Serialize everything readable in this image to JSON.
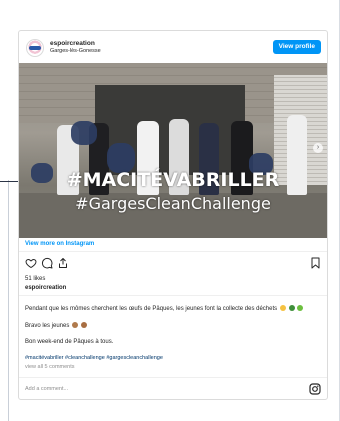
{
  "header": {
    "username": "espoircreation",
    "location": "Garges-lès-Gonesse",
    "view_profile": "View profile"
  },
  "photo": {
    "overlay_title": "#MACITÉVABRILLER",
    "overlay_subtitle": "#GargesCleanChallenge"
  },
  "view_more": "View more on Instagram",
  "icons": [
    "heart-icon",
    "comment-icon",
    "share-icon",
    "bookmark-icon",
    "instagram-icon"
  ],
  "post": {
    "likes": "51 likes",
    "owner": "espoircreation",
    "caption_line1": "Pendant que les mômes cherchent les œufs de Pâques, les jeunes font la collecte des déchets",
    "caption_line2": "Bravo les jeunes",
    "caption_line3": "Bon week-end de Pâques à tous.",
    "hashtags": "#macitévabriller #cleanchallenge #gargescleanchallenge",
    "view_comments": "view all 5 comments"
  },
  "comment": {
    "placeholder": "Add a comment..."
  },
  "colors": {
    "accent": "#0095f6",
    "hashtag": "#00376b",
    "muted": "#8e8e8e"
  }
}
